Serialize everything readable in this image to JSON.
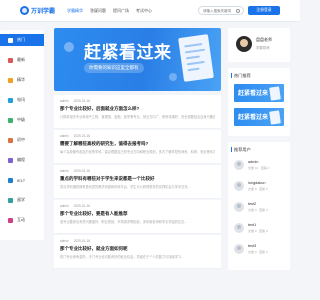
{
  "header": {
    "logo_text": "万训学霸",
    "nav": [
      "学霸精华",
      "答疑问题",
      "提问广场",
      "考试中心"
    ],
    "nav_active_index": 0,
    "search_placeholder": "请输入搜索关键词",
    "login_label": "注册登录"
  },
  "sidebar": {
    "items": [
      {
        "label": "热门",
        "icon": "fire-icon",
        "color": "#ffffff"
      },
      {
        "label": "最新",
        "icon": "clock-icon",
        "color": "#e05555"
      },
      {
        "label": "精华",
        "icon": "star-icon",
        "color": "#f0a020"
      },
      {
        "label": "电讯",
        "icon": "signal-icon",
        "color": "#20a0e0"
      },
      {
        "label": "中级",
        "icon": "book-icon",
        "color": "#40b070"
      },
      {
        "label": "初中",
        "icon": "school-icon",
        "color": "#e07040"
      },
      {
        "label": "编程",
        "icon": "code-icon",
        "color": "#8060d0"
      },
      {
        "label": "IELT",
        "icon": "globe-icon",
        "color": "#2080d0"
      },
      {
        "label": "留学",
        "icon": "plane-icon",
        "color": "#30a0a0"
      },
      {
        "label": "互动",
        "icon": "chat-icon",
        "color": "#d04080"
      }
    ]
  },
  "banner": {
    "title": "赶紧看过来",
    "subtitle": "你需要的知识这里全都有"
  },
  "articles": [
    {
      "author": "admin",
      "date": "2025-01-16",
      "tag": "热门",
      "title": "那个专业比较好，后面就业方面怎么样?",
      "desc": "计算机相关专业和电气工程、管理类、金融、医学等专业，就业方向广、薪资待遇好，但也需要结合自身兴趣选择...",
      "views": "12",
      "comments": "0"
    },
    {
      "author": "admin",
      "date": "2025-01-16",
      "tag": "热门",
      "title": "需要了解哪些高校的研究生，值得去报考吗?",
      "desc": "每个高校都有各自的优势学科，建议根据自己的专业方向和职业规划，多方了解学校的师资、科研、就业等情况...",
      "views": "9",
      "comments": "0"
    },
    {
      "author": "admin",
      "date": "2025-01-16",
      "tag": "热门",
      "title": "重点的学科有哪些对于学生来说都是一个比较好",
      "desc": "重点学科通常拥有更优质的教学资源和科研平台，学生可以获得更多的实践机会与学术交流...",
      "views": "7",
      "comments": "0"
    },
    {
      "author": "admin",
      "date": "2025-01-16",
      "tag": "热门",
      "title": "那个专业比较好，要是有人能推荐",
      "desc": "选专业要综合考虑兴趣爱好、职业规划、市场需求等因素，多听取老师和学长学姐的意见...",
      "views": "6",
      "comments": "0"
    },
    {
      "author": "admin",
      "date": "2025-01-16",
      "tag": "热门",
      "title": "那个专业比较好，就业方面如何呢",
      "desc": "热门专业竞争激烈，冷门专业也可能有好的就业机会，关键在于个人的能力与持续学习...",
      "views": "5",
      "comments": "0"
    }
  ],
  "profile": {
    "name": "盘盘老师",
    "subtitle": "学霸导师"
  },
  "side_panel": {
    "title": "热门推荐",
    "mini_banner_text": "赶紧看过来"
  },
  "users_panel": {
    "title": "推荐用户",
    "users": [
      {
        "name": "admin",
        "meta": "文章 10 · 回答 0"
      },
      {
        "name": "longdakun",
        "meta": "文章 0 · 回答 0"
      },
      {
        "name": "test2",
        "meta": "文章 0 · 回答 0"
      },
      {
        "name": "test1",
        "meta": "文章 0 · 回答 0"
      },
      {
        "name": "test3",
        "meta": "文章 0 · 回答 0"
      }
    ]
  },
  "colors": {
    "accent": "#1a73e8",
    "background": "#f3f5f8"
  }
}
